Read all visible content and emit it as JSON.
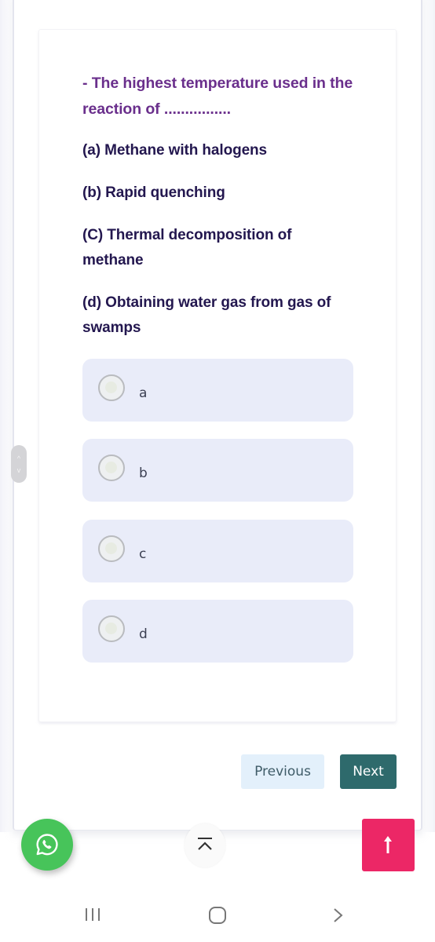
{
  "quiz": {
    "question": "- The highest temperature used in the reaction of ................",
    "choices": [
      "(a) Methane with halogens",
      "(b) Rapid quenching",
      "(C) Thermal decomposition of methane",
      "(d) Obtaining water gas from gas of swamps"
    ],
    "options": [
      {
        "label": "a",
        "selected": false
      },
      {
        "label": "b",
        "selected": false
      },
      {
        "label": "c",
        "selected": false
      },
      {
        "label": "d",
        "selected": false
      }
    ]
  },
  "navigation": {
    "previous_label": "Previous",
    "next_label": "Next"
  },
  "floating": {
    "whatsapp_icon": "whatsapp-icon",
    "scroll_top_icon": "chevron-up-bar-icon",
    "back_to_top_icon": "arrow-up-icon"
  },
  "side_handle": {
    "up_glyph": "^",
    "down_glyph": "v"
  },
  "system_nav": {
    "recent_apps_icon": "recent-apps-icon",
    "home_icon": "home-icon",
    "back_icon": "back-chevron-icon"
  },
  "colors": {
    "question_purple": "#6a2f8c",
    "choice_navy": "#23174f",
    "option_bg": "#e9ecf9",
    "previous_bg": "#e3f0fb",
    "next_bg": "#2e6a6c",
    "whatsapp_green": "#47c45a",
    "back_to_top_pink": "#ec2766"
  }
}
